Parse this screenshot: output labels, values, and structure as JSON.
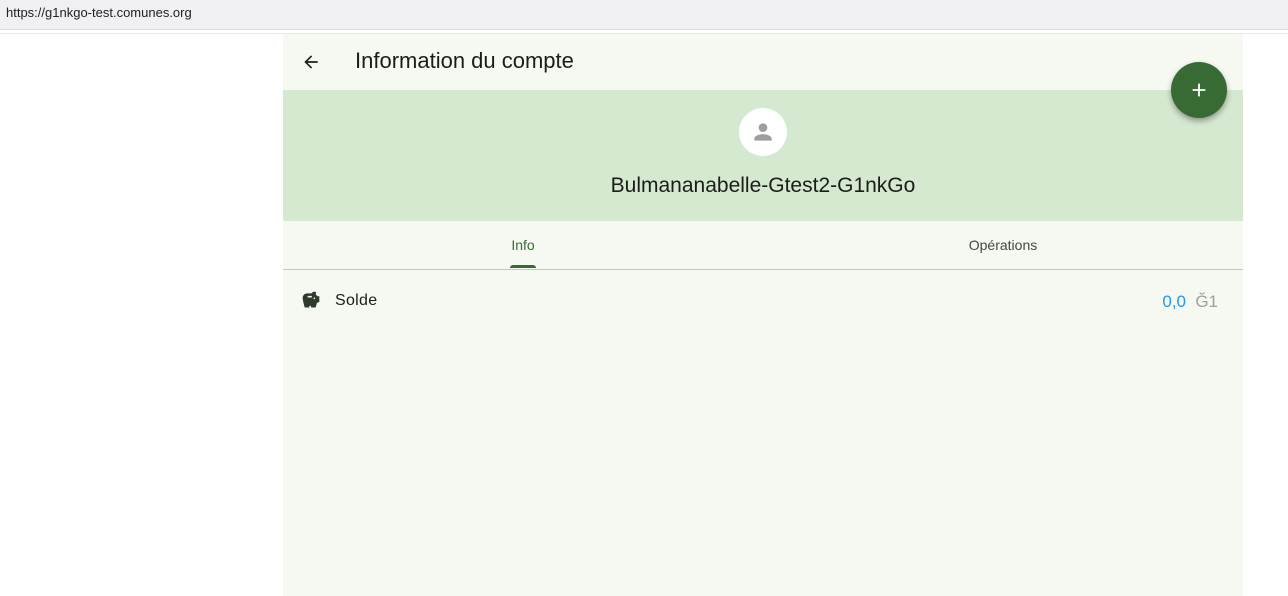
{
  "browser": {
    "url": "https://g1nkgo-test.comunes.org"
  },
  "appbar": {
    "title": "Information du compte",
    "back_icon": "arrow-back-icon"
  },
  "header": {
    "account_name": "Bulmananabelle-Gtest2-G1nkGo",
    "avatar_icon": "person-icon"
  },
  "fab": {
    "icon": "add-icon"
  },
  "tabs": [
    {
      "label": "Info",
      "selected": true
    },
    {
      "label": "Opérations",
      "selected": false
    }
  ],
  "balance_row": {
    "icon": "piggy-bank-icon",
    "label": "Solde",
    "value": "0,0",
    "unit": "Ğ1"
  },
  "colors": {
    "primary": "#386a34",
    "header_bg": "#d5e8d0",
    "surface": "#f6f9f1",
    "balance_value": "#2196f3"
  }
}
